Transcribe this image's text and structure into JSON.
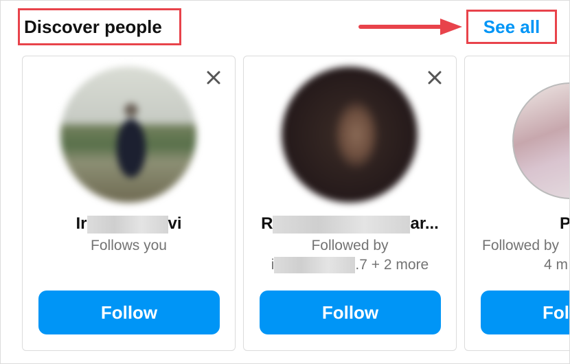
{
  "header": {
    "title": "Discover people",
    "see_all": "See all"
  },
  "cards": [
    {
      "name_start": "Ir",
      "name_end": "vi",
      "subtitle_line1": "Follows you",
      "follow_label": "Follow"
    },
    {
      "name_start": "R",
      "name_end": "ar...",
      "subtitle_line1": "Followed by",
      "subtitle_line2_start": "i",
      "subtitle_line2_end": ".7 + 2 more",
      "follow_label": "Follow"
    },
    {
      "name_start": "P",
      "subtitle_line1": "Followed by",
      "subtitle_line2_end": "4 m",
      "follow_label": "Fol"
    }
  ],
  "colors": {
    "accent": "#0095f6",
    "highlight": "#e8434b"
  },
  "icons": [
    "close-icon",
    "arrow-right-icon"
  ]
}
